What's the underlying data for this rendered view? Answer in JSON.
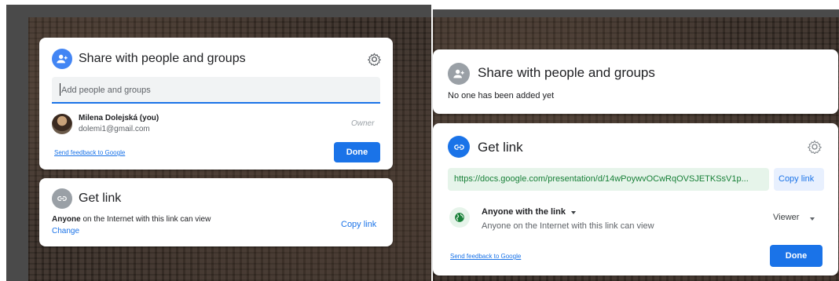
{
  "left_panel": {
    "share": {
      "title": "Share with people and groups",
      "input_placeholder": "Add people and groups",
      "user": {
        "name": "Milena Dolejská (you)",
        "email": "dolemi1@gmail.com",
        "role": "Owner"
      },
      "feedback_link": "Send feedback to Google",
      "done_label": "Done"
    },
    "get_link": {
      "title": "Get link",
      "access_bold": "Anyone",
      "access_rest": " on the Internet with this link can view",
      "change_link": "Change",
      "copy_link": "Copy link"
    }
  },
  "right_panel": {
    "share": {
      "title": "Share with people and groups",
      "empty_text": "No one has been added yet"
    },
    "get_link": {
      "title": "Get link",
      "url": "https://docs.google.com/presentation/d/14wPoywvOCwRqOVSJETKSsV1p...",
      "copy_link": "Copy link",
      "access_title": "Anyone with the link",
      "access_desc": "Anyone on the Internet with this link can view",
      "role": "Viewer",
      "feedback_link": "Send feedback to Google",
      "done_label": "Done"
    }
  },
  "colors": {
    "accent": "#1a73e8",
    "green_icon": "#188038",
    "url_bg": "#e6f4ea",
    "url_text": "#188038"
  }
}
